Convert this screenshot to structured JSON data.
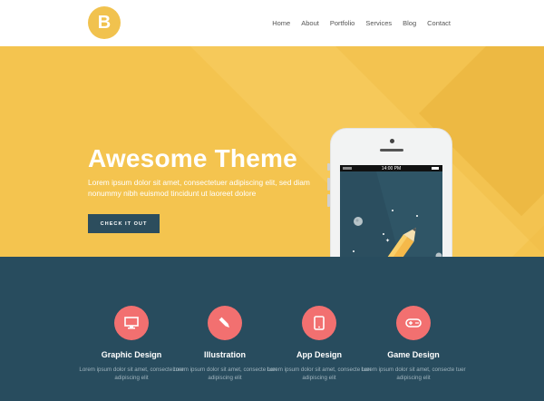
{
  "brand": {
    "logo_letter": "B"
  },
  "nav": {
    "items": [
      "Home",
      "About",
      "Portfolio",
      "Services",
      "Blog",
      "Contact"
    ]
  },
  "hero": {
    "title": "Awesome Theme",
    "text": "Lorem ipsum dolor sit amet, consectetuer adipiscing elit, sed diam nonummy nibh euismod tincidunt ut laoreet dolore",
    "cta_label": "CHECK IT OUT"
  },
  "phone": {
    "time": "14:00 PM"
  },
  "services": [
    {
      "title": "Graphic Design",
      "text": "Lorem ipsum dolor sit amet, consecte tuer adipiscing elit",
      "icon": "monitor-icon"
    },
    {
      "title": "Illustration",
      "text": "Lorem ipsum dolor sit amet, consecte tuer adipiscing elit",
      "icon": "pencil-icon"
    },
    {
      "title": "App Design",
      "text": "Lorem ipsum dolor sit amet, consecte tuer adipiscing elit",
      "icon": "tablet-icon"
    },
    {
      "title": "Game Design",
      "text": "Lorem ipsum dolor sit amet, consecte tuer adipiscing elit",
      "icon": "gamepad-icon"
    }
  ],
  "colors": {
    "accent_yellow": "#f4c44f",
    "dark_teal": "#284c5e",
    "coral": "#f27070",
    "rocket_orange": "#f39c3c"
  }
}
